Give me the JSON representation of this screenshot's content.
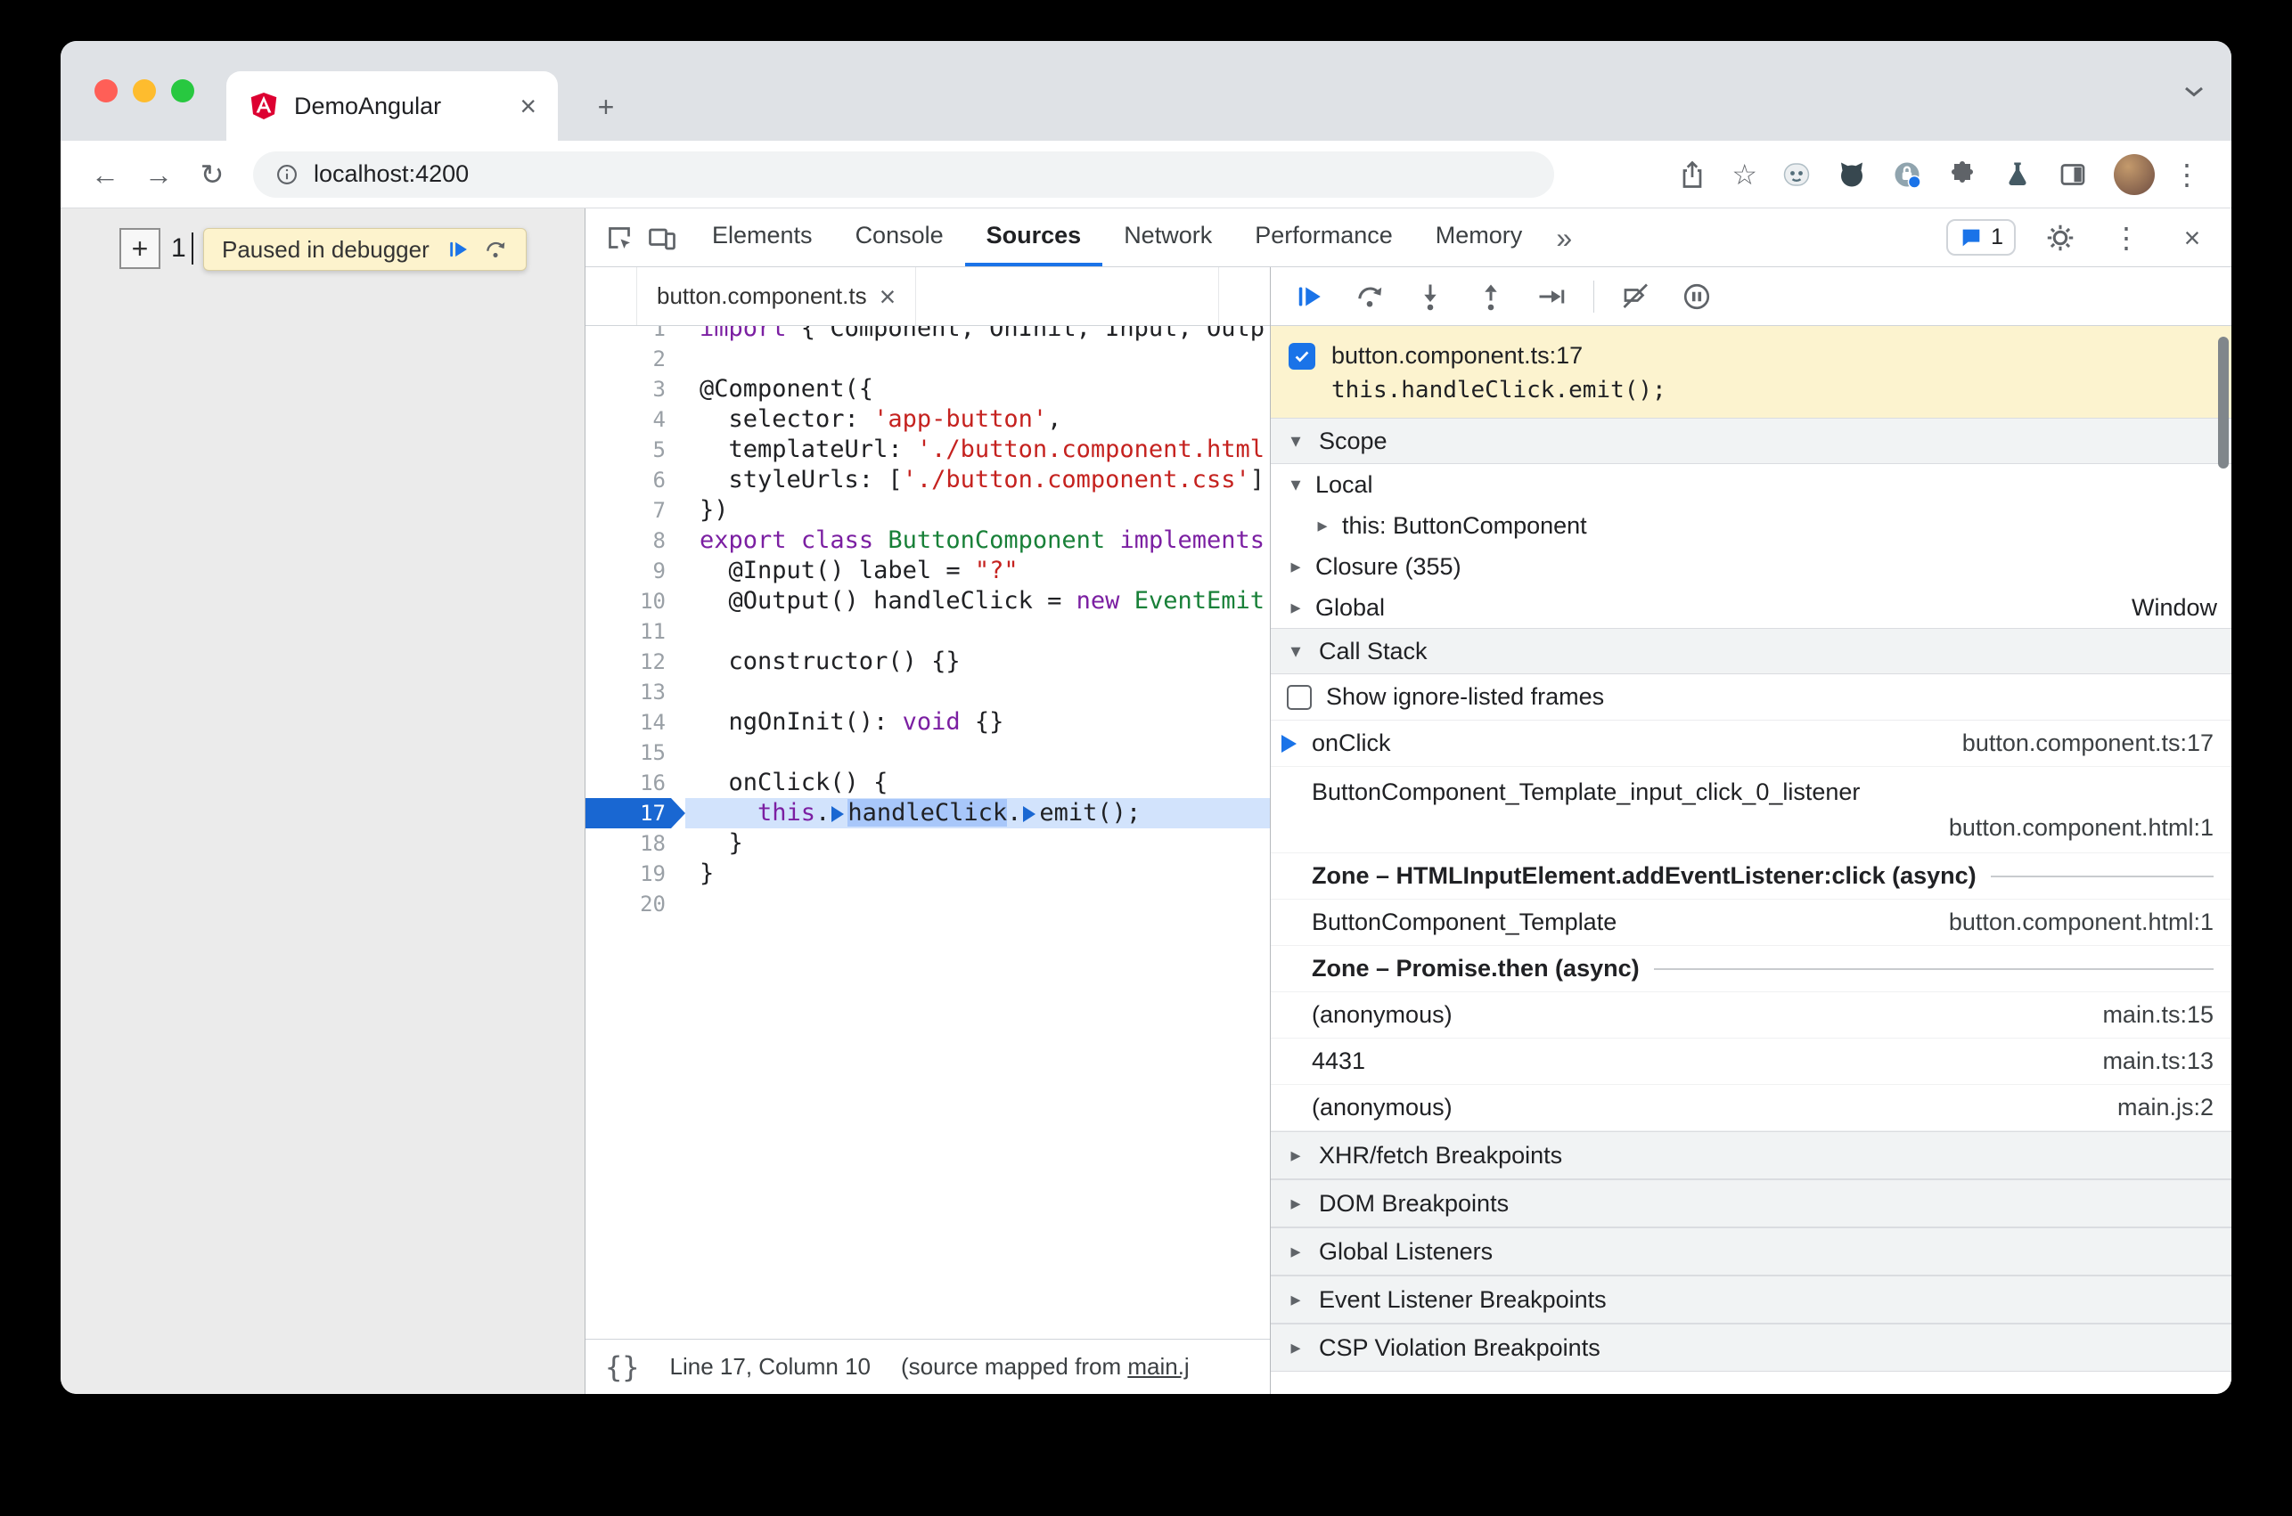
{
  "colors": {
    "accent": "#1a73e8",
    "paused_banner": "#fdf3cd",
    "execution_line": "#d2e3fc",
    "selection": "#a8c7fa",
    "keyword": "#7b1fa2",
    "string": "#c5221f",
    "type": "#188038"
  },
  "browser": {
    "tab": {
      "title": "DemoAngular"
    },
    "url": "localhost:4200",
    "toolbar_icons": [
      "share",
      "star",
      "mask",
      "cat",
      "privacy",
      "puzzle",
      "flask",
      "tab-split"
    ]
  },
  "page": {
    "button_label": "+",
    "counter": "1",
    "paused": {
      "label": "Paused in debugger",
      "icons": [
        "resume",
        "step-over"
      ]
    }
  },
  "devtools": {
    "tabs": [
      {
        "label": "Elements"
      },
      {
        "label": "Console"
      },
      {
        "label": "Sources",
        "active": true
      },
      {
        "label": "Network"
      },
      {
        "label": "Performance"
      },
      {
        "label": "Memory"
      }
    ],
    "console_count": "1",
    "file_tab": "button.component.ts",
    "editor": {
      "current_line": 17,
      "lines": [
        {
          "n": "1",
          "tokens": [
            [
              "k",
              "import"
            ],
            [
              "p",
              " { Component, OnInit, Input, Outp"
            ]
          ]
        },
        {
          "n": "2",
          "tokens": []
        },
        {
          "n": "3",
          "tokens": [
            [
              "p",
              "@Component({"
            ]
          ]
        },
        {
          "n": "4",
          "tokens": [
            [
              "p",
              "  selector: "
            ],
            [
              "s",
              "'app-button'"
            ],
            [
              "p",
              ","
            ]
          ]
        },
        {
          "n": "5",
          "tokens": [
            [
              "p",
              "  templateUrl: "
            ],
            [
              "s",
              "'./button.component.html"
            ]
          ]
        },
        {
          "n": "6",
          "tokens": [
            [
              "p",
              "  styleUrls: ["
            ],
            [
              "s",
              "'./button.component.css'"
            ],
            [
              "p",
              "]"
            ]
          ]
        },
        {
          "n": "7",
          "tokens": [
            [
              "p",
              "})"
            ]
          ]
        },
        {
          "n": "8",
          "tokens": [
            [
              "k",
              "export"
            ],
            [
              "p",
              " "
            ],
            [
              "k",
              "class"
            ],
            [
              "p",
              " "
            ],
            [
              "c",
              "ButtonComponent"
            ],
            [
              "p",
              " "
            ],
            [
              "k",
              "implements"
            ]
          ]
        },
        {
          "n": "9",
          "tokens": [
            [
              "p",
              "  @Input() label = "
            ],
            [
              "s",
              "\"?\""
            ]
          ]
        },
        {
          "n": "10",
          "tokens": [
            [
              "p",
              "  @Output() handleClick = "
            ],
            [
              "k",
              "new"
            ],
            [
              "p",
              " "
            ],
            [
              "c",
              "EventEmit"
            ]
          ]
        },
        {
          "n": "11",
          "tokens": []
        },
        {
          "n": "12",
          "tokens": [
            [
              "p",
              "  constructor() {}"
            ]
          ]
        },
        {
          "n": "13",
          "tokens": []
        },
        {
          "n": "14",
          "tokens": [
            [
              "p",
              "  ngOnInit(): "
            ],
            [
              "k",
              "void"
            ],
            [
              "p",
              " {}"
            ]
          ]
        },
        {
          "n": "15",
          "tokens": []
        },
        {
          "n": "16",
          "tokens": [
            [
              "p",
              "  onClick() {"
            ]
          ]
        },
        {
          "n": "17",
          "tokens": [
            [
              "p",
              "    "
            ],
            [
              "k",
              "this"
            ],
            [
              "p",
              "."
            ],
            [
              "m",
              ""
            ],
            [
              "sel",
              "handleClick"
            ],
            [
              "p",
              "."
            ],
            [
              "m",
              ""
            ],
            [
              "p",
              "emit();"
            ]
          ],
          "current": true
        },
        {
          "n": "18",
          "tokens": [
            [
              "p",
              "  }"
            ]
          ]
        },
        {
          "n": "19",
          "tokens": [
            [
              "p",
              "}"
            ]
          ]
        },
        {
          "n": "20",
          "tokens": []
        }
      ]
    },
    "status_bar": {
      "position": "Line 17, Column 10",
      "mapped_prefix": "(source mapped from ",
      "mapped_link": "main.j"
    },
    "debugger": {
      "toolbar_icons": [
        "resume",
        "step-over",
        "step-into",
        "step-out",
        "step",
        "deactivate-breakpoints",
        "pause-exceptions"
      ],
      "paused_message": {
        "location": "button.component.ts:17",
        "code": "this.handleClick.emit();"
      },
      "scope": {
        "title": "Scope",
        "rows": [
          {
            "label": "Local",
            "state": "expanded",
            "indent": 0
          },
          {
            "label": "this: ButtonComponent",
            "state": "collapsed",
            "indent": 1
          },
          {
            "label": "Closure (355)",
            "state": "collapsed",
            "indent": 0
          },
          {
            "label": "Global",
            "value": "Window",
            "state": "collapsed",
            "indent": 0
          }
        ]
      },
      "call_stack": {
        "title": "Call Stack",
        "filter_label": "Show ignore-listed frames",
        "frames": [
          {
            "name": "onClick",
            "location": "button.component.ts:17",
            "active": true
          },
          {
            "name": "ButtonComponent_Template_input_click_0_listener",
            "location": "button.component.html:1",
            "wrap": true
          },
          {
            "name": "Zone – HTMLInputElement.addEventListener:click (async)",
            "type": "async"
          },
          {
            "name": "ButtonComponent_Template",
            "location": "button.component.html:1"
          },
          {
            "name": "Zone – Promise.then (async)",
            "type": "async"
          },
          {
            "name": "(anonymous)",
            "location": "main.ts:15"
          },
          {
            "name": "4431",
            "location": "main.ts:13"
          },
          {
            "name": "(anonymous)",
            "location": "main.js:2"
          }
        ]
      },
      "sections": [
        "XHR/fetch Breakpoints",
        "DOM Breakpoints",
        "Global Listeners",
        "Event Listener Breakpoints",
        "CSP Violation Breakpoints"
      ]
    }
  }
}
